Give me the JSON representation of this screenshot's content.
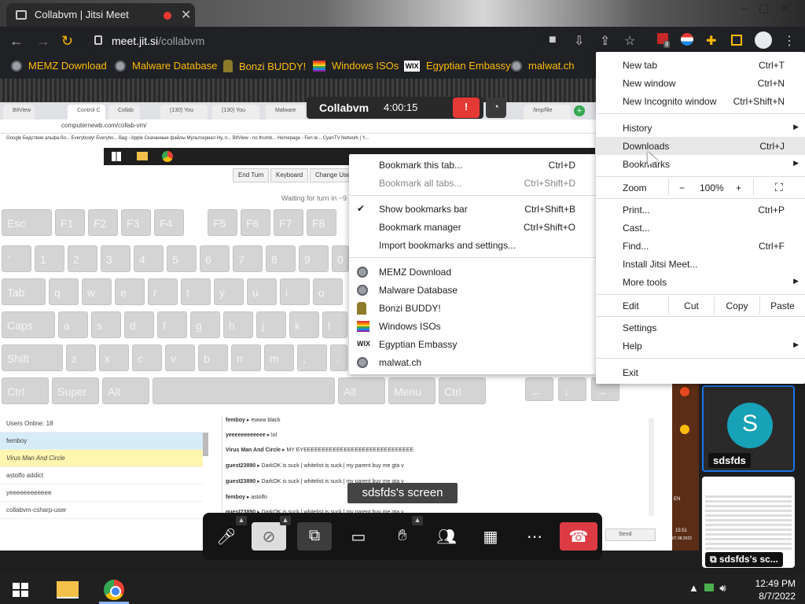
{
  "window": {
    "tab_title": "Collabvm | Jitsi Meet"
  },
  "toolbar": {
    "host": "meet.jit.si",
    "path": "/collabvm",
    "badge": "8"
  },
  "bookmarks_bar": [
    {
      "label": "MEMZ Download",
      "icon": "globe-icon"
    },
    {
      "label": "Malware Database",
      "icon": "globe-icon"
    },
    {
      "label": "Bonzi BUDDY!",
      "icon": "bonzi-icon"
    },
    {
      "label": "Windows ISOs",
      "icon": "rainbow-icon"
    },
    {
      "label": "Egyptian Embassy",
      "icon": "wix-icon"
    },
    {
      "label": "malwat.ch",
      "icon": "globe-icon"
    }
  ],
  "meeting": {
    "name": "Collabvm",
    "timer": "4:00:15",
    "screen_label": "sdsfds's screen"
  },
  "vm": {
    "inner_address": "computernewb.com/collab-vm/",
    "inner_tabs": [
      "BitView",
      "Control C",
      "Collab",
      "(130) You",
      "(130) You",
      "Malware",
      "/tmp/file"
    ],
    "inner_bookmarks": "Google   Бедствие альфа-бо...   Everybody! Everybo...   Bag - Apple   Скачанные файлы   Мультсериал Ну, п...   BitView - no thumb...   Homepage - Fen le...   CyanTV Network | Y...",
    "buttons": [
      "End Turn",
      "Keyboard",
      "Change Use"
    ],
    "waiting": "Waiting for turn in ~9 s",
    "keys": {
      "row1": [
        "Esc",
        "F1",
        "F2",
        "F3",
        "F4",
        "F5",
        "F6",
        "F7",
        "F8"
      ],
      "row2": [
        "`",
        "1",
        "2",
        "3",
        "4",
        "5",
        "6",
        "7",
        "8",
        "9",
        "0"
      ],
      "row3": [
        "Tab",
        "q",
        "w",
        "e",
        "r",
        "t",
        "y",
        "u",
        "i",
        "o"
      ],
      "row4": [
        "Caps",
        "a",
        "s",
        "d",
        "f",
        "g",
        "h",
        "j",
        "k",
        "l"
      ],
      "row5": [
        "Shift",
        "z",
        "x",
        "c",
        "v",
        "b",
        "n",
        "m",
        ",",
        "."
      ],
      "row6": [
        "Ctrl",
        "Super",
        "Alt",
        "",
        "Alt",
        "Menu",
        "Ctrl"
      ],
      "arrows": [
        "←",
        "↓",
        "→"
      ]
    },
    "users_header": "Users Online: 18",
    "users": [
      "femboy",
      "Virus Man And Circle",
      "astolfo addict",
      "yeeeeeeeeeeee",
      "collabvm-csharp-user"
    ],
    "chat": [
      {
        "user": "femboy",
        "msg": "ewww black"
      },
      {
        "user": "yeeeeeeeeeeee",
        "msg": "lol"
      },
      {
        "user": "Virus Man And Circle",
        "msg": "MY EYEEEEEEEEEEEEEEEEEEEEEEEEEEEEEE"
      },
      {
        "user": "guest23890",
        "msg": "DarkOK is suck | whitelist is suck | my parent buy me gta v"
      },
      {
        "user": "guest23890",
        "msg": "DarkOK is suck | whitelist is suck | my parent buy me gta v"
      },
      {
        "user": "femboy",
        "msg": "astolfo"
      },
      {
        "user": "guest23890",
        "msg": "DarkOK is suck | whitelist is suck | my parent buy me gta v"
      }
    ],
    "send": "Send",
    "vm_clock": [
      "15:51",
      "07.08.2022"
    ],
    "vm_lang": "EN"
  },
  "participants": [
    {
      "initial": "S",
      "name": "sdsfds"
    },
    {
      "name": "sdsfds's sc..."
    }
  ],
  "bookmarks_menu": {
    "items": [
      {
        "label": "Bookmark this tab...",
        "shortcut": "Ctrl+D"
      },
      {
        "label": "Bookmark all tabs...",
        "shortcut": "Ctrl+Shift+D",
        "disabled": true
      },
      {
        "label": "Show bookmarks bar",
        "shortcut": "Ctrl+Shift+B",
        "checked": true
      },
      {
        "label": "Bookmark manager",
        "shortcut": "Ctrl+Shift+O"
      },
      {
        "label": "Import bookmarks and settings...",
        "shortcut": ""
      },
      {
        "label": "MEMZ Download",
        "icon": "globe-icon"
      },
      {
        "label": "Malware Database",
        "icon": "globe-icon"
      },
      {
        "label": "Bonzi BUDDY!",
        "icon": "bonzi-icon"
      },
      {
        "label": "Windows ISOs",
        "icon": "rainbow-icon"
      },
      {
        "label": "Egyptian Embassy",
        "icon": "wix-icon"
      },
      {
        "label": "malwat.ch",
        "icon": "globe-icon"
      }
    ]
  },
  "main_menu": {
    "new_tab": "New tab",
    "new_tab_sc": "Ctrl+T",
    "new_window": "New window",
    "new_window_sc": "Ctrl+N",
    "incognito": "New Incognito window",
    "incognito_sc": "Ctrl+Shift+N",
    "history": "History",
    "downloads": "Downloads",
    "downloads_sc": "Ctrl+J",
    "bookmarks": "Bookmarks",
    "zoom": "Zoom",
    "zoom_minus": "−",
    "zoom_level": "100%",
    "zoom_plus": "+",
    "print": "Print...",
    "print_sc": "Ctrl+P",
    "cast": "Cast...",
    "find": "Find...",
    "find_sc": "Ctrl+F",
    "install": "Install Jitsi Meet...",
    "more_tools": "More tools",
    "edit": "Edit",
    "cut": "Cut",
    "copy": "Copy",
    "paste": "Paste",
    "settings": "Settings",
    "help": "Help",
    "exit": "Exit"
  },
  "taskbar": {
    "time": "12:49 PM",
    "date": "8/7/2022"
  }
}
